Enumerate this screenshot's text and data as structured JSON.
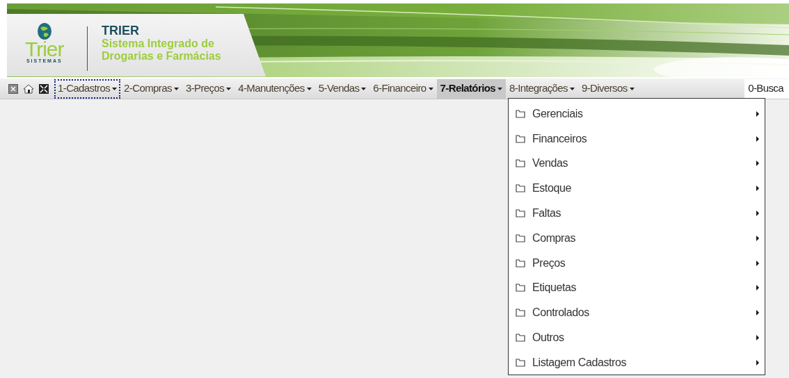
{
  "header": {
    "logo_text": "Trier",
    "logo_subtext": "SISTEMAS",
    "title": "TRIER",
    "subtitle_lines": [
      "Sistema Integrado de",
      "Drogarias e Farmácias"
    ]
  },
  "toolbar_icons": [
    {
      "kind": "close"
    },
    {
      "kind": "home"
    },
    {
      "kind": "fullscreen"
    }
  ],
  "menu": [
    {
      "label": "1-Cadastros",
      "kind": "dropdown",
      "selected": false,
      "focused": true
    },
    {
      "label": "2-Compras",
      "kind": "dropdown",
      "selected": false,
      "focused": false
    },
    {
      "label": "3-Preços",
      "kind": "dropdown",
      "selected": false,
      "focused": false
    },
    {
      "label": "4-Manutenções",
      "kind": "dropdown",
      "selected": false,
      "focused": false
    },
    {
      "label": "5-Vendas",
      "kind": "dropdown",
      "selected": false,
      "focused": false
    },
    {
      "label": "6-Financeiro",
      "kind": "dropdown",
      "selected": false,
      "focused": false
    },
    {
      "label": "7-Relatórios",
      "kind": "dropdown",
      "selected": true,
      "focused": false
    },
    {
      "label": "8-Integrações",
      "kind": "dropdown",
      "selected": false,
      "focused": false
    },
    {
      "label": "9-Diversos",
      "kind": "dropdown",
      "selected": false,
      "focused": false
    },
    {
      "label": "0-Busca",
      "kind": "search",
      "selected": false,
      "focused": false
    }
  ],
  "dropdown": {
    "items": [
      {
        "label": "Gerenciais",
        "has_submenu": true
      },
      {
        "label": "Financeiros",
        "has_submenu": true
      },
      {
        "label": "Vendas",
        "has_submenu": true
      },
      {
        "label": "Estoque",
        "has_submenu": true
      },
      {
        "label": "Faltas",
        "has_submenu": true
      },
      {
        "label": "Compras",
        "has_submenu": true
      },
      {
        "label": "Preços",
        "has_submenu": true
      },
      {
        "label": "Etiquetas",
        "has_submenu": true
      },
      {
        "label": "Controlados",
        "has_submenu": true
      },
      {
        "label": "Outros",
        "has_submenu": true
      },
      {
        "label": "Listagem Cadastros",
        "has_submenu": true
      }
    ]
  }
}
